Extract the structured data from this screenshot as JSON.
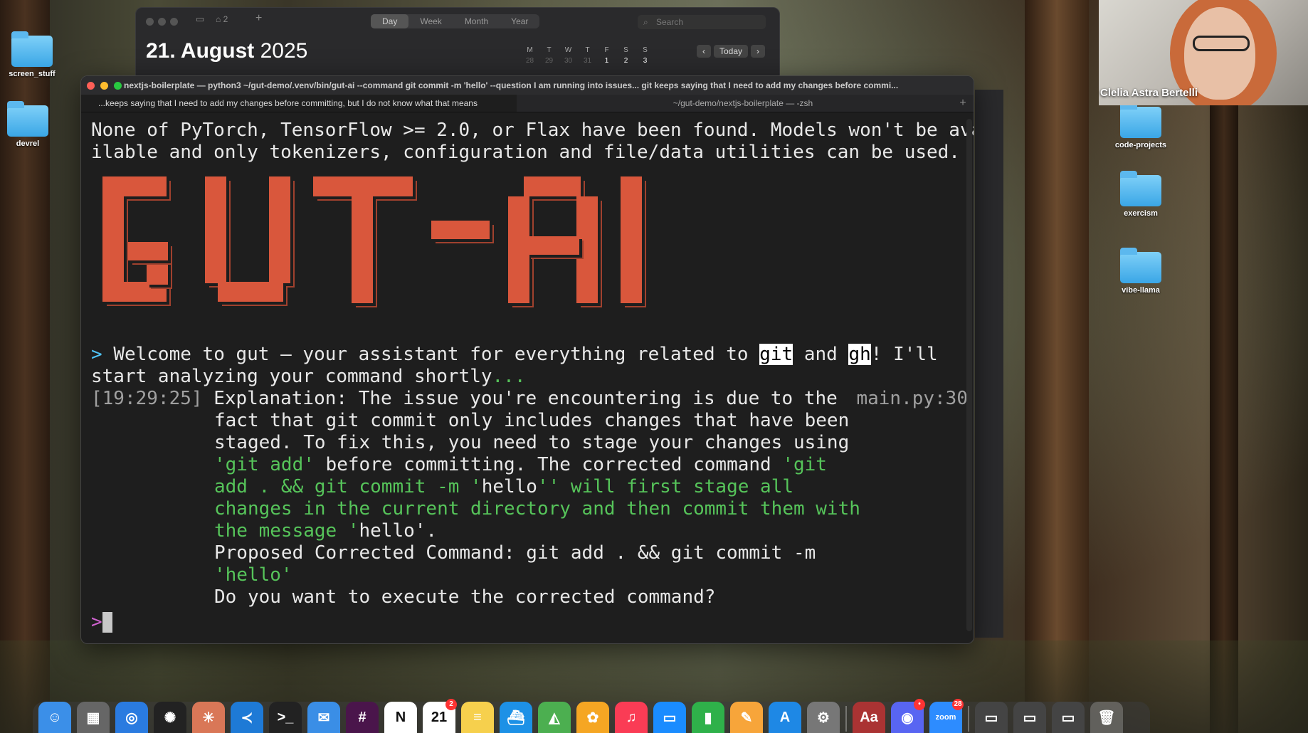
{
  "desktop": {
    "left_icons": [
      {
        "label": "screen_stuff"
      },
      {
        "label": "devrel"
      }
    ],
    "right_icons": [
      {
        "label": "code-projects"
      },
      {
        "label": "exercism"
      },
      {
        "label": "vibe-llama"
      }
    ]
  },
  "calendar": {
    "notif_count": "2",
    "views": [
      "Day",
      "Week",
      "Month",
      "Year"
    ],
    "active_view": "Day",
    "search_placeholder": "Search",
    "date_bold": "21. August",
    "year": "2025",
    "mini_headers": [
      "M",
      "T",
      "W",
      "T",
      "F",
      "S",
      "S"
    ],
    "mini_row": [
      "28",
      "29",
      "30",
      "31",
      "1",
      "2",
      "3"
    ],
    "today_label": "Today"
  },
  "terminal": {
    "title": "nextjs-boilerplate — python3 ~/gut-demo/.venv/bin/gut-ai --command git commit -m 'hello' --question I am running into issues... git keeps saying that I need to add my changes before commi...",
    "tabs": [
      "...keeps saying that I need to add my changes before committing, but I do not know what that means",
      "~/gut-demo/nextjs-boilerplate — -zsh"
    ],
    "warning_1": "None of PyTorch, TensorFlow >= 2.0, or Flax have been found. Models won't be ava",
    "warning_2": "ilable and only tokenizers, configuration and file/data utilities can be used.",
    "welcome_prefix": "> ",
    "welcome_a": "Welcome to gut — your assistant for everything related to ",
    "welcome_git": "git",
    "welcome_and": " and ",
    "welcome_gh": "gh",
    "welcome_b": "! I'll",
    "welcome_2": "start analyzing your command shortly",
    "welcome_dots": "...",
    "timestamp": "[19:29:25]",
    "source_ref": "main.py:30",
    "expl_1": "Explanation: The issue you're encountering is due to the",
    "expl_2": "fact that git commit only includes changes that have been",
    "expl_3": "staged. To fix this, you need to stage your changes using",
    "expl_4a": "'git add'",
    "expl_4b": " before committing. The corrected command ",
    "expl_4c": "'git",
    "expl_5a": "add . && git commit -m '",
    "expl_5b": "hello",
    "expl_5c": "'' will first stage all",
    "expl_6": "changes in the current directory and then commit them with",
    "expl_7a": "the message ",
    "expl_7b": "'",
    "expl_7c": "hello'.",
    "proposed_1": "Proposed Corrected Command: git add . && git commit -m",
    "proposed_2": "'hello'",
    "question": "Do you want to execute the corrected command?",
    "prompt": ">"
  },
  "banner_text": "GUT-AI",
  "webcam": {
    "name": "Clelia Astra Bertelli"
  },
  "dock": {
    "items": [
      {
        "icon": "finder-icon",
        "glyph": "☺",
        "color": "#3b8fe8"
      },
      {
        "icon": "launchpad-icon",
        "glyph": "▦",
        "color": "#666"
      },
      {
        "icon": "safari-icon",
        "glyph": "◎",
        "color": "#2a7be0"
      },
      {
        "icon": "chatgpt-icon",
        "glyph": "✺",
        "color": "#222"
      },
      {
        "icon": "claude-icon",
        "glyph": "✳",
        "color": "#d97757"
      },
      {
        "icon": "vscode-icon",
        "glyph": "≺",
        "color": "#1e7ad6"
      },
      {
        "icon": "terminal-icon",
        "glyph": ">_",
        "color": "#222"
      },
      {
        "icon": "mail-icon",
        "glyph": "✉",
        "color": "#3a8ee6"
      },
      {
        "icon": "slack-icon",
        "glyph": "#",
        "color": "#4a154b"
      },
      {
        "icon": "notion-icon",
        "glyph": "N",
        "color": "#fff"
      },
      {
        "icon": "calendar-icon",
        "glyph": "21",
        "color": "#fff",
        "badge": "2"
      },
      {
        "icon": "notes-icon",
        "glyph": "≡",
        "color": "#f6d04d"
      },
      {
        "icon": "docker-icon",
        "glyph": "⛴",
        "color": "#1d91e6"
      },
      {
        "icon": "maps-icon",
        "glyph": "◭",
        "color": "#4caf50"
      },
      {
        "icon": "photos-icon",
        "glyph": "✿",
        "color": "#f5a623"
      },
      {
        "icon": "music-icon",
        "glyph": "♫",
        "color": "#fa3c55"
      },
      {
        "icon": "keynote-icon",
        "glyph": "▭",
        "color": "#1a8cff"
      },
      {
        "icon": "numbers-icon",
        "glyph": "▮",
        "color": "#2fb14a"
      },
      {
        "icon": "pages-icon",
        "glyph": "✎",
        "color": "#f7a53a"
      },
      {
        "icon": "app-store-icon",
        "glyph": "A",
        "color": "#1e88e5"
      },
      {
        "icon": "system-settings-icon",
        "glyph": "⚙",
        "color": "#777"
      },
      {
        "icon": "dictionary-icon",
        "glyph": "Aa",
        "color": "#a33"
      },
      {
        "icon": "discord-icon",
        "glyph": "◉",
        "color": "#5865f2",
        "badge": "•"
      },
      {
        "icon": "zoom-icon",
        "glyph": "zoom",
        "color": "#2d8cff",
        "badge": "28"
      }
    ],
    "trash_icon": "trash-icon"
  }
}
